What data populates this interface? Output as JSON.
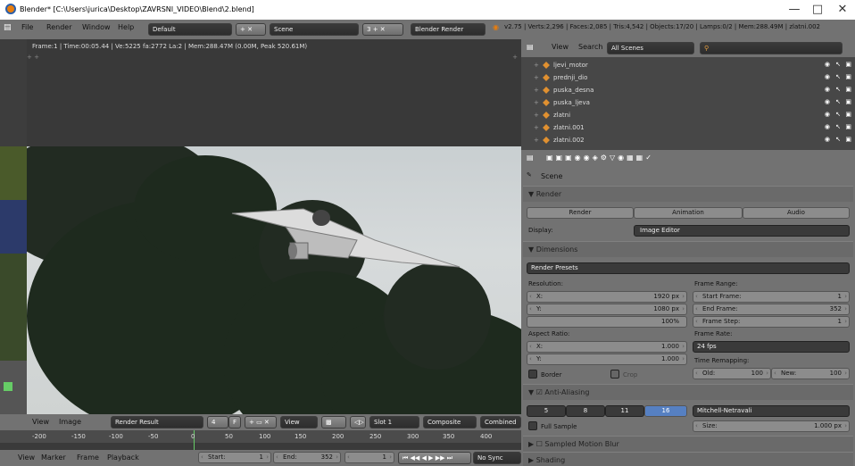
{
  "window": {
    "title": "Blender* [C:\\Users\\jurica\\Desktop\\ZAVRSNI_VIDEO\\Blend\\2.blend]",
    "min": "—",
    "max": "□",
    "close": "✕"
  },
  "info_header": {
    "menus": [
      "File",
      "Render",
      "Window",
      "Help"
    ],
    "layout": "Default",
    "scene": "Scene",
    "scene_count": "3",
    "engine": "Blender Render",
    "stats": "v2.75 | Verts:2,296 | Faces:2,085 | Tris:4,542 | Objects:17/20 | Lamps:0/2 | Mem:288.49M | zlatni.002"
  },
  "viewport": {
    "info": "Frame:1 | Time:00:05.44 | Ve:5225 fa:2772 La:2 | Mem:288.47M (0.00M, Peak 520.61M)"
  },
  "outliner": {
    "view": "View",
    "search": "Search",
    "filter": "All Scenes",
    "items": [
      "ljevi_motor",
      "prednji_dio",
      "puska_desna",
      "puska_ljeva",
      "zlatni",
      "zlatni.001",
      "zlatni.002"
    ]
  },
  "properties": {
    "context": "Scene",
    "render": {
      "header": "Render",
      "render_btn": "Render",
      "animation_btn": "Animation",
      "audio_btn": "Audio",
      "display_label": "Display:",
      "display_value": "Image Editor"
    },
    "dimensions": {
      "header": "Dimensions",
      "presets": "Render Presets",
      "resolution": "Resolution:",
      "x_label": "X:",
      "x_val": "1920 px",
      "y_label": "Y:",
      "y_val": "1080 px",
      "percent": "100%",
      "aspect": "Aspect Ratio:",
      "ax_label": "X:",
      "ax_val": "1.000",
      "ay_label": "Y:",
      "ay_val": "1.000",
      "border": "Border",
      "crop": "Crop",
      "frame_range": "Frame Range:",
      "start_label": "Start Frame:",
      "start_val": "1",
      "end_label": "End Frame:",
      "end_val": "352",
      "step_label": "Frame Step:",
      "step_val": "1",
      "frame_rate": "Frame Rate:",
      "fps": "24 fps",
      "remap": "Time Remapping:",
      "old_label": "Old:",
      "old_val": "100",
      "new_label": "New:",
      "new_val": "100"
    },
    "aa": {
      "header": "Anti-Aliasing",
      "samples": [
        "5",
        "8",
        "11",
        "16"
      ],
      "selected": "16",
      "filter": "Mitchell-Netravali",
      "full_sample": "Full Sample",
      "size_label": "Size:",
      "size_val": "1.000 px"
    },
    "motion_blur": "Sampled Motion Blur",
    "shading": "Shading"
  },
  "image_header": {
    "view": "View",
    "image": "Image",
    "result": "Render Result",
    "num": "4",
    "f": "F",
    "view2": "View",
    "slot": "Slot 1",
    "composite": "Composite",
    "combined": "Combined"
  },
  "timeline": {
    "ticks": [
      "-200",
      "-150",
      "-100",
      "-50",
      "0",
      "50",
      "100",
      "150",
      "200",
      "250",
      "300",
      "350",
      "400"
    ]
  },
  "timeline_header": {
    "view": "View",
    "marker": "Marker",
    "frame": "Frame",
    "playback": "Playback",
    "start_label": "Start:",
    "start_val": "1",
    "end_label": "End:",
    "end_val": "352",
    "current": "1",
    "nosync": "No Sync"
  }
}
